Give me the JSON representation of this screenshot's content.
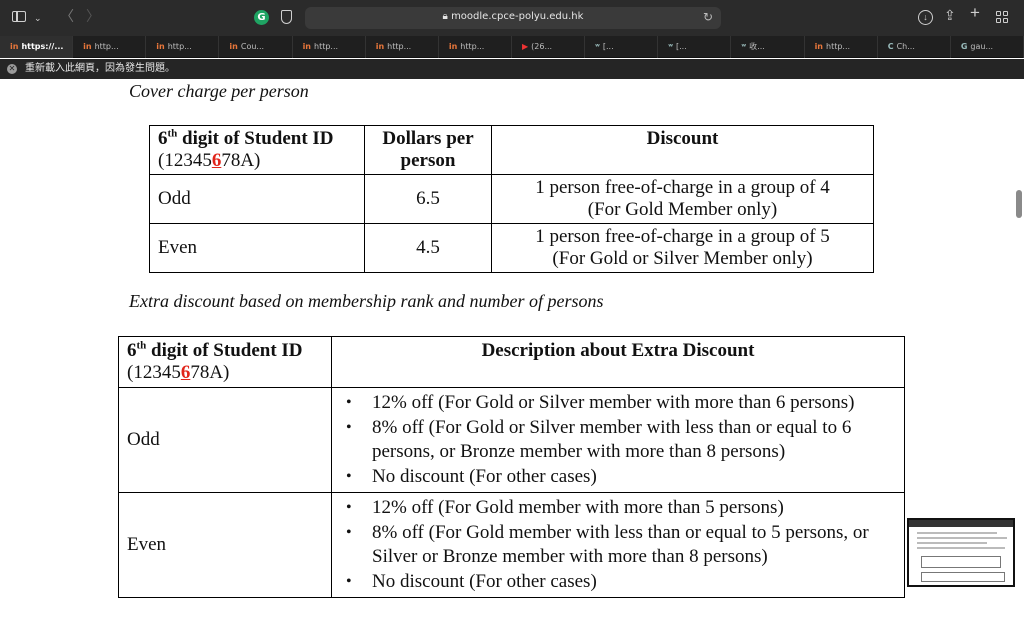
{
  "browser": {
    "url": "moodle.cpce-polyu.edu.hk",
    "ext_g_letter": "G",
    "tabs": [
      {
        "label": "https://...",
        "icon": "in",
        "active": true
      },
      {
        "label": "http...",
        "icon": "in"
      },
      {
        "label": "http...",
        "icon": "in"
      },
      {
        "label": "Cou...",
        "icon": "in"
      },
      {
        "label": "http...",
        "icon": "in"
      },
      {
        "label": "http...",
        "icon": "in"
      },
      {
        "label": "http...",
        "icon": "in"
      },
      {
        "label": "(26...",
        "icon": "▶"
      },
      {
        "label": "[...",
        "icon": "ʷ"
      },
      {
        "label": "[...",
        "icon": "ʷ"
      },
      {
        "label": "收...",
        "icon": "ʷ"
      },
      {
        "label": "http...",
        "icon": "in"
      },
      {
        "label": "Ch...",
        "icon": "C"
      },
      {
        "label": "gau...",
        "icon": "G"
      }
    ],
    "info_bar": "重新載入此網頁，因為發生問題。"
  },
  "table1": {
    "title": "Cover charge per person",
    "headers": {
      "col1_pre": "6",
      "col1_sup": "th",
      "col1_post": " digit of Student ID",
      "id_a": "(12345",
      "id_digit": "6",
      "id_b": "78A)",
      "col2": "Dollars per person",
      "col3": "Discount"
    },
    "rows": [
      {
        "label": "Odd",
        "price": "6.5",
        "discount_1": "1 person free-of-charge in a group of 4",
        "discount_2": "(For Gold Member only)"
      },
      {
        "label": "Even",
        "price": "4.5",
        "discount_1": "1 person free-of-charge in a group of 5",
        "discount_2": "(For Gold or Silver Member only)"
      }
    ]
  },
  "table2": {
    "title": "Extra discount based on membership rank and number of persons",
    "headers": {
      "col1_pre": "6",
      "col1_sup": "th",
      "col1_post": " digit of Student ID",
      "id_a": "(12345",
      "id_digit": "6",
      "id_b": "78A)",
      "col2": "Description about Extra Discount"
    },
    "rows": [
      {
        "label": "Odd",
        "items": [
          "12% off (For Gold or Silver member with more than 6 persons)",
          "8% off (For Gold or Silver member with less than or equal to 6 persons, or Bronze member with more than 8 persons)",
          "No discount (For other cases)"
        ]
      },
      {
        "label": "Even",
        "items": [
          "12% off (For Gold member with more than 5 persons)",
          "8% off (For Gold member with less than or equal to 5 persons, or Silver or Bronze member with more than 8 persons)",
          "No discount (For other cases)"
        ]
      }
    ]
  },
  "colors": {
    "chrome": "#2b2b2b",
    "tabbar": "#1f1f1f",
    "highlight_digit": "#e1251b"
  },
  "icons": [
    "sidebar-toggle-icon",
    "chevron-down-icon",
    "back-arrow-icon",
    "forward-arrow-icon",
    "grammarly-icon",
    "privacy-shield-icon",
    "lock-icon",
    "reload-icon",
    "download-icon",
    "share-icon",
    "new-tab-icon",
    "tab-overview-icon",
    "close-circle-icon"
  ]
}
